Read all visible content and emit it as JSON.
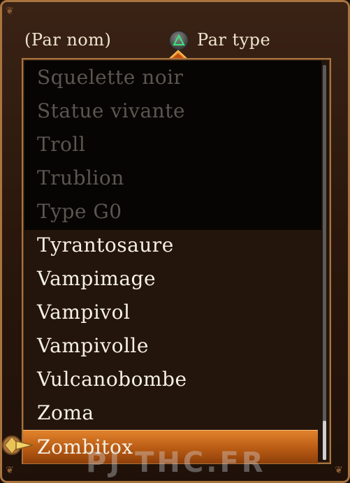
{
  "header": {
    "sort_by_name_label": "(Par nom)",
    "sort_by_type_label": "Par type",
    "toggle_button_icon": "triangle-button-icon"
  },
  "list": {
    "items": [
      {
        "label": "Squelette noir",
        "state": "dim"
      },
      {
        "label": "Statue vivante",
        "state": "dim"
      },
      {
        "label": "Troll",
        "state": "dim"
      },
      {
        "label": "Trublion",
        "state": "dim"
      },
      {
        "label": "Type G0",
        "state": "dim"
      },
      {
        "label": "Tyrantosaure",
        "state": "normal"
      },
      {
        "label": "Vampimage",
        "state": "normal"
      },
      {
        "label": "Vampivol",
        "state": "normal"
      },
      {
        "label": "Vampivolle",
        "state": "normal"
      },
      {
        "label": "Vulcanobombe",
        "state": "normal"
      },
      {
        "label": "Zoma",
        "state": "normal"
      },
      {
        "label": "Zombitox",
        "state": "selected"
      }
    ]
  },
  "watermark": "PJ THC.FR",
  "colors": {
    "frame_border": "#a9743f",
    "selected_highlight": "#d06e1f",
    "text": "#f6f1e6",
    "dim_text": "#5b5650"
  }
}
